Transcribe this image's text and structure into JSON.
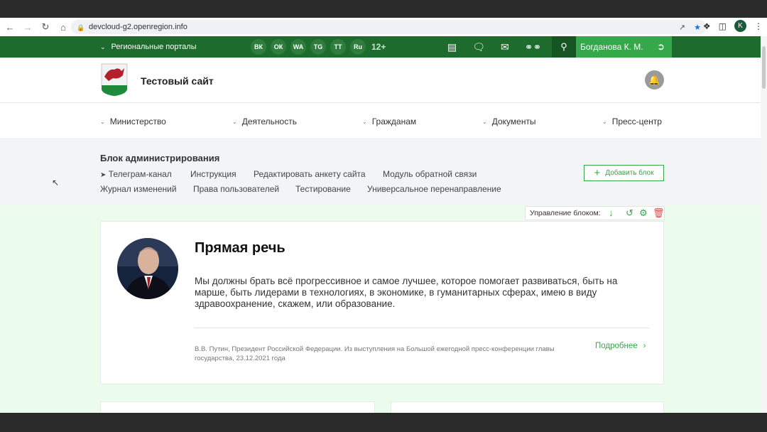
{
  "browser": {
    "url": "devcloud-g2.openregion.info",
    "profile_initial": "K"
  },
  "topbar": {
    "regional_label": "Региональные порталы",
    "socials": [
      "ВК",
      "ОК",
      "WA",
      "TG",
      "TT",
      "Ru"
    ],
    "age_rating": "12+",
    "user_name": "Богданова К. М."
  },
  "header": {
    "site_title": "Тестовый сайт"
  },
  "mainnav": {
    "items": [
      "Министерство",
      "Деятельность",
      "Гражданам",
      "Документы",
      "Пресс-центр"
    ]
  },
  "admin": {
    "title": "Блок администрирования",
    "links_row1": [
      "Телеграм-канал",
      "Инструкция",
      "Редактировать анкету сайта",
      "Модуль обратной связи"
    ],
    "links_row2": [
      "Журнал изменений",
      "Права пользователей",
      "Тестирование",
      "Универсальное перенаправление"
    ],
    "add_block_label": "Добавить блок"
  },
  "block_manager": {
    "label": "Управление блоком:"
  },
  "quote_card": {
    "title": "Прямая речь",
    "text": "Мы должны брать всё прогрессивное и самое лучшее, которое помогает развиваться, быть на марше, быть лидерами в технологиях, в экономике, в гуманитарных сферах, имею в виду здравоохранение, скажем, или образование.",
    "source": "В.В. Путин, Президент Российской Федерации. Из выступления на Большой ежегодной пресс-конференции главы государства, 23.12.2021 года",
    "more_label": "Подробнее"
  },
  "colors": {
    "brand_green": "#1e6b2e",
    "accent_green": "#35a84a",
    "bg_green": "#ebfbec"
  }
}
